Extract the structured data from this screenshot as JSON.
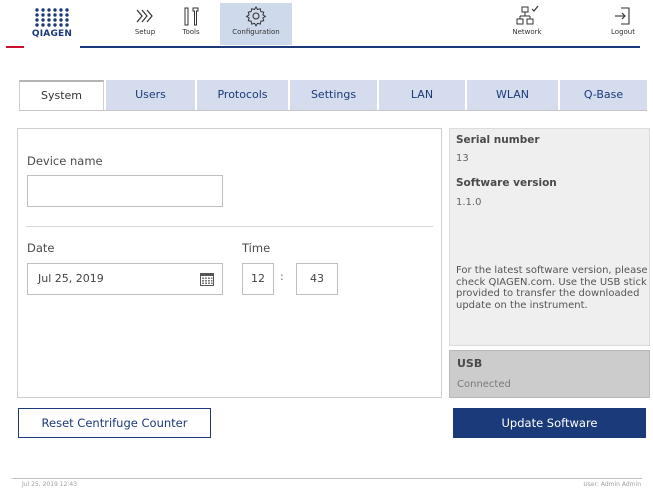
{
  "header": {
    "logo_text": "QIAGEN",
    "nav": [
      {
        "label": "Setup",
        "icon": "chevrons-right-icon"
      },
      {
        "label": "Tools",
        "icon": "tools-icon"
      },
      {
        "label": "Configuration",
        "icon": "gear-icon",
        "active": true
      },
      {
        "label": "Network",
        "icon": "network-icon"
      },
      {
        "label": "Logout",
        "icon": "logout-icon"
      }
    ]
  },
  "tabs": [
    "System",
    "Users",
    "Protocols",
    "Settings",
    "LAN",
    "WLAN",
    "Q-Base"
  ],
  "active_tab": "System",
  "system": {
    "device_name_label": "Device name",
    "device_name_value": "",
    "date_label": "Date",
    "date_value": "Jul 25, 2019",
    "time_label": "Time",
    "time_hour": "12",
    "time_sep": ":",
    "time_minute": "43"
  },
  "info": {
    "serial_label": "Serial number",
    "serial_value": "13",
    "software_label": "Software version",
    "software_value": "1.1.0",
    "note": "For the latest software version, please check QIAGEN.com. Use the USB stick provided to transfer the downloaded update on the instrument."
  },
  "usb": {
    "title": "USB",
    "status": "Connected"
  },
  "buttons": {
    "reset_counter": "Reset Centrifuge Counter",
    "update_software": "Update Software"
  },
  "footer": {
    "datetime": "Jul 25, 2019  12:43",
    "user": "User: Admin Admin"
  },
  "colors": {
    "primary": "#1b3a7a",
    "accent_red": "#c8102e",
    "tab_inactive": "#d5dced",
    "nav_active": "#cfd9ec"
  }
}
